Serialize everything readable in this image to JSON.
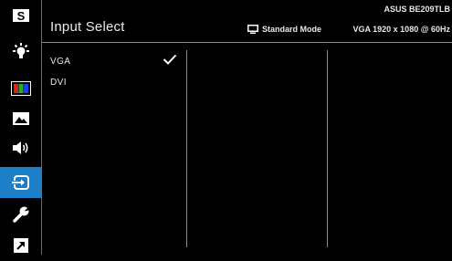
{
  "header": {
    "title": "Input Select",
    "mode": "Standard Mode",
    "model": "ASUS BE209TLB",
    "timing": "VGA 1920 x 1080 @ 60Hz"
  },
  "sidebar": {
    "items": [
      {
        "icon": "splendid-icon",
        "active": false
      },
      {
        "icon": "blue-light-filter-icon",
        "active": false
      },
      {
        "icon": "color-icon",
        "active": false
      },
      {
        "icon": "image-icon",
        "active": false
      },
      {
        "icon": "sound-icon",
        "active": false
      },
      {
        "icon": "input-select-icon",
        "active": true
      },
      {
        "icon": "system-setup-icon",
        "active": false
      },
      {
        "icon": "shortcut-icon",
        "active": false
      }
    ]
  },
  "options": [
    {
      "label": "VGA",
      "selected": true
    },
    {
      "label": "DVI",
      "selected": false
    }
  ],
  "colors": {
    "accent": "#1e7fc8",
    "background": "#000000",
    "text": "#e6e6e6"
  }
}
